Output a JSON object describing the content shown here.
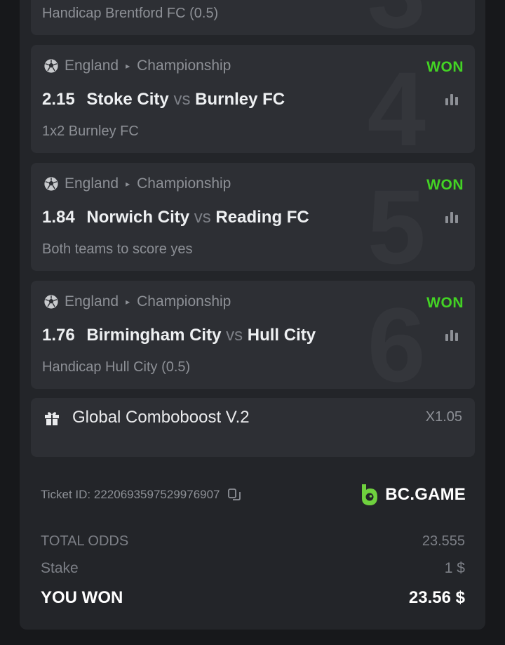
{
  "bets": [
    {
      "number": "3",
      "market": "Handicap Brentford FC (0.5)"
    },
    {
      "number": "4",
      "country": "England",
      "league": "Championship",
      "status": "WON",
      "odds": "2.15",
      "home": "Stoke City",
      "vs": "vs",
      "away": "Burnley FC",
      "market": "1x2 Burnley FC"
    },
    {
      "number": "5",
      "country": "England",
      "league": "Championship",
      "status": "WON",
      "odds": "1.84",
      "home": "Norwich City",
      "vs": "vs",
      "away": "Reading FC",
      "market": "Both teams to score yes"
    },
    {
      "number": "6",
      "country": "England",
      "league": "Championship",
      "status": "WON",
      "odds": "1.76",
      "home": "Birmingham City",
      "vs": "vs",
      "away": "Hull City",
      "market": "Handicap Hull City (0.5)"
    }
  ],
  "combo": {
    "title": "Global Comboboost V.2",
    "multiplier": "X1.05"
  },
  "ticket": {
    "label": "Ticket ID: 2220693597529976907"
  },
  "brand": {
    "name": "BC.GAME",
    "color": "#6fd13e"
  },
  "summary": {
    "total_odds_label": "TOTAL ODDS",
    "total_odds_value": "23.555",
    "stake_label": "Stake",
    "stake_value": "1 $",
    "won_label": "YOU WON",
    "won_value": "23.56 $"
  },
  "colors": {
    "won": "#43d324",
    "background": "#17181b",
    "card": "#2d2f34"
  }
}
